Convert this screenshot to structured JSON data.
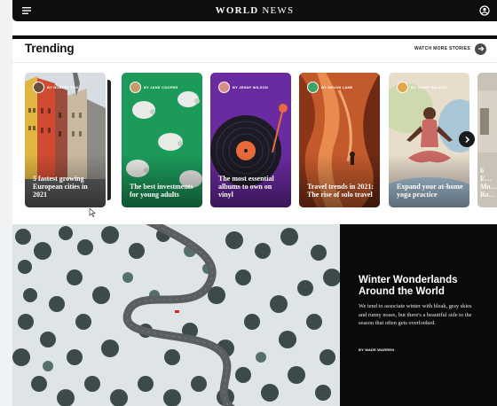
{
  "header": {
    "brand_bold": "WORLD",
    "brand_rest": " NEWS"
  },
  "trending": {
    "title": "Trending",
    "watch_more": "WATCH MORE STORIES",
    "cards": [
      {
        "author": "BY ROBERT FOX",
        "title": "5 fastest growing European cities in 2021"
      },
      {
        "author": "BY JANE COOPER",
        "title": "The best investments for young adults"
      },
      {
        "author": "BY JENNY WILSON",
        "title": "The most essential albums to own on vinyl"
      },
      {
        "author": "BY DEVON LANE",
        "title": "Travel trends in 2021: The rise of solo travel"
      },
      {
        "author": "BY JENNY WILSON",
        "title": "Expand your at-home yoga practice"
      },
      {
        "author": "",
        "title": "6 E… Mo… Ro…"
      }
    ]
  },
  "feature": {
    "title": "Winter Wonderlands Around the World",
    "body": "We tend to associate winter with bleak, gray skies and runny noses, but there's a beautiful side to the season that often gets overlooked.",
    "author": "BY WADE WARREN"
  },
  "icons": [
    "menu-icon",
    "user-icon",
    "arrow-right-icon",
    "chevron-right-icon",
    "cursor-icon"
  ]
}
